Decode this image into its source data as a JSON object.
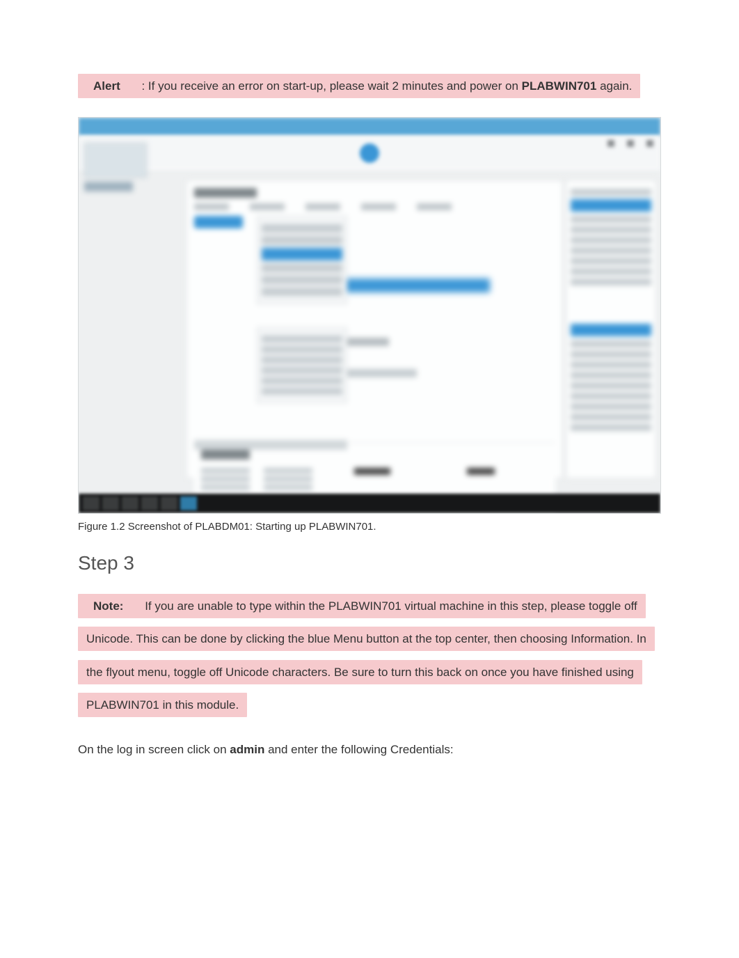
{
  "alert": {
    "label": "Alert",
    "text_part1": ": If you receive an error on start-up, please wait 2 minutes and power on ",
    "bold_host": "PLABWIN701",
    "text_part2": " again."
  },
  "figure_caption": "Figure 1.2 Screenshot of PLABDM01: Starting up PLABWIN701.",
  "step_heading": "Step 3",
  "note": {
    "label": "Note:",
    "text": "If you are unable to type within the PLABWIN701 virtual machine in this step, please toggle off Unicode. This can be done by clicking the blue Menu button at the top center, then choosing Information. In the flyout menu, toggle off Unicode characters. Be sure to turn this back on once you have finished using PLABWIN701 in this module."
  },
  "instruction": {
    "part1": "On the log in screen click on ",
    "bold": "admin",
    "part2": " and enter the following Credentials:"
  }
}
